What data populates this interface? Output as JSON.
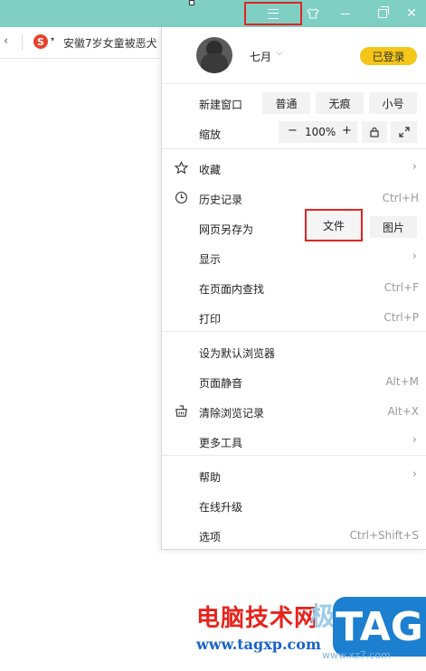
{
  "window": {
    "skin_icon": "shirt-icon",
    "menu_icon": "hamburger-icon",
    "minimize_icon": "minimize-icon",
    "restore_icon": "restore-icon",
    "close_glyph": "✕"
  },
  "tab": {
    "arrow": "‹",
    "logo_text": "S",
    "caret": "▾",
    "title": "安徽7岁女童被恶犬"
  },
  "menu": {
    "user": {
      "name": "七月",
      "caret": "⌵",
      "login_label": "已登录"
    },
    "new_window": {
      "label": "新建窗口",
      "options": [
        "普通",
        "无痕",
        "小号"
      ]
    },
    "zoom": {
      "label": "缩放",
      "minus": "−",
      "value": "100%",
      "plus": "+",
      "lock_icon": "lock-icon",
      "fullscreen_icon": "fullscreen-icon"
    },
    "items": [
      {
        "label": "收藏",
        "icon": "star-icon",
        "shortcut": "",
        "submenu": true
      },
      {
        "label": "历史记录",
        "icon": "clock-icon",
        "shortcut": "Ctrl+H",
        "submenu": false
      },
      {
        "label": "网页另存为",
        "icon": "",
        "shortcut": "",
        "submenu": false,
        "options": [
          "文件",
          "图片"
        ]
      },
      {
        "label": "显示",
        "icon": "",
        "shortcut": "",
        "submenu": true
      },
      {
        "label": "在页面内查找",
        "icon": "",
        "shortcut": "Ctrl+F",
        "submenu": false
      },
      {
        "label": "打印",
        "icon": "",
        "shortcut": "Ctrl+P",
        "submenu": false
      },
      {
        "label": "设为默认浏览器",
        "icon": "",
        "shortcut": "",
        "submenu": false
      },
      {
        "label": "页面静音",
        "icon": "",
        "shortcut": "Alt+M",
        "submenu": false
      },
      {
        "label": "清除浏览记录",
        "icon": "broom-icon",
        "shortcut": "Alt+X",
        "submenu": false
      },
      {
        "label": "更多工具",
        "icon": "",
        "shortcut": "",
        "submenu": true
      },
      {
        "label": "帮助",
        "icon": "",
        "shortcut": "",
        "submenu": true
      },
      {
        "label": "在线升级",
        "icon": "",
        "shortcut": "",
        "submenu": false
      },
      {
        "label": "选项",
        "icon": "",
        "shortcut": "Ctrl+Shift+S",
        "submenu": false
      }
    ],
    "chevron": "›"
  },
  "watermark": {
    "site_name": "电脑技术网",
    "url": "www.tagxp.com",
    "tag": "TAG",
    "sub_url": "www.xz7.com",
    "ji": "极"
  },
  "colors": {
    "titlebar": "#7fcfc3",
    "login_badge": "#f5c518",
    "highlight_box": "#e02424",
    "watermark_red": "#e8231b",
    "watermark_blue": "#1a63c9",
    "tag_bg": "#1d7fcf"
  }
}
